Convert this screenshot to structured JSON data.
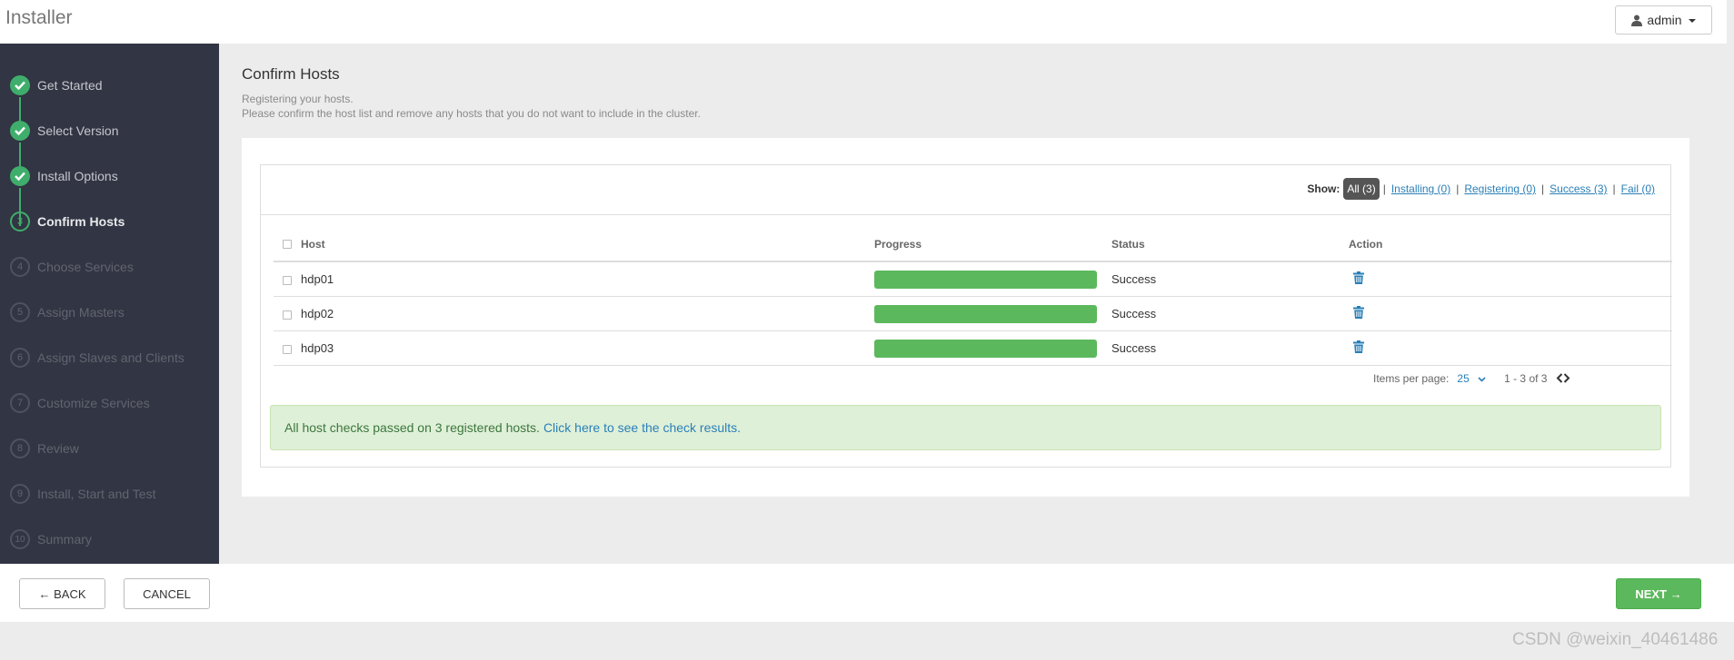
{
  "app": {
    "title": "Installer",
    "user": "admin"
  },
  "steps": [
    {
      "number": "1",
      "label": "Get Started",
      "state": "done"
    },
    {
      "number": "2",
      "label": "Select Version",
      "state": "done"
    },
    {
      "number": "3",
      "label": "Install Options",
      "state": "done"
    },
    {
      "number": "3",
      "label": "Confirm Hosts",
      "state": "current"
    },
    {
      "number": "4",
      "label": "Choose Services",
      "state": "todo"
    },
    {
      "number": "5",
      "label": "Assign Masters",
      "state": "todo"
    },
    {
      "number": "6",
      "label": "Assign Slaves and Clients",
      "state": "todo"
    },
    {
      "number": "7",
      "label": "Customize Services",
      "state": "todo"
    },
    {
      "number": "8",
      "label": "Review",
      "state": "todo"
    },
    {
      "number": "9",
      "label": "Install, Start and Test",
      "state": "todo"
    },
    {
      "number": "10",
      "label": "Summary",
      "state": "todo"
    }
  ],
  "page": {
    "title": "Confirm Hosts",
    "subtitle1": "Registering your hosts.",
    "subtitle2": "Please confirm the host list and remove any hosts that you do not want to include in the cluster."
  },
  "filters": {
    "show_label": "Show:",
    "all": "All (3)",
    "installing": "Installing (0)",
    "registering": "Registering (0)",
    "success": "Success (3)",
    "fail": "Fail (0)"
  },
  "table": {
    "columns": {
      "host": "Host",
      "progress": "Progress",
      "status": "Status",
      "action": "Action"
    },
    "rows": [
      {
        "host": "hdp01",
        "progress": 1.0,
        "status": "Success"
      },
      {
        "host": "hdp02",
        "progress": 1.0,
        "status": "Success"
      },
      {
        "host": "hdp03",
        "progress": 1.0,
        "status": "Success"
      }
    ]
  },
  "pager": {
    "items_label": "Items per page:",
    "per_page": "25",
    "range": "1 - 3 of 3"
  },
  "alert": {
    "text": "All host checks passed on 3 registered hosts.",
    "link": "Click here to see the check results."
  },
  "footer": {
    "back": "← BACK",
    "cancel": "CANCEL",
    "next": "NEXT →"
  },
  "watermark": "CSDN @weixin_40461486",
  "colors": {
    "sidebar": "#323543",
    "success": "#5cb85c",
    "step_done": "#3fae6c",
    "link": "#2a7fb8"
  },
  "icons": [
    "user-icon",
    "check-icon",
    "trash-icon",
    "chevron-left-icon",
    "chevron-right-icon"
  ]
}
